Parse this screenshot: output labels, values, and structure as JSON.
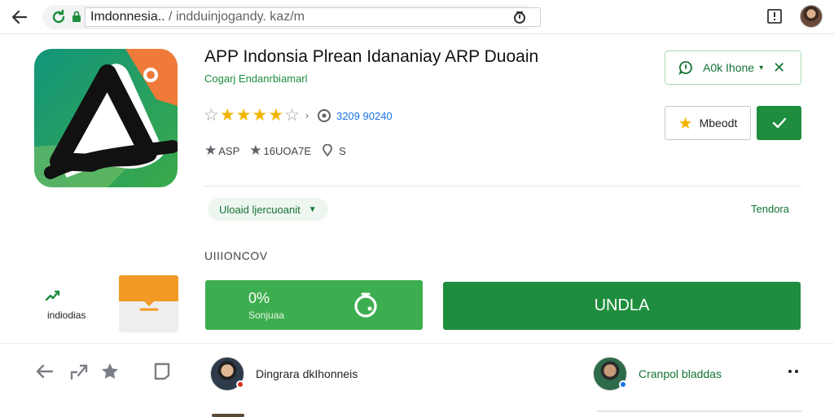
{
  "browser": {
    "url_host": "Imdonnesia..",
    "url_path": " / indduinjogandy. kaz/m",
    "icons": [
      "back-arrow-icon",
      "reload-icon",
      "lock-icon",
      "share-icon",
      "extension-icon",
      "profile-avatar"
    ]
  },
  "app": {
    "title": "APP Indonsia Plrean Idananiay ARP Duoain",
    "developer": "Cogarj Endanrbiamarl",
    "rating": {
      "full_stars": 4,
      "empty_stars": 2,
      "separator": "›",
      "count": "3209 90240"
    },
    "meta": {
      "category": "ASP",
      "version": "16UOA7E",
      "age": "S"
    }
  },
  "buttons": {
    "outline_label": "A0k Ihone",
    "wishlist_label": "Mbeodt",
    "install_label": "UNDLA"
  },
  "chip": {
    "label": "Uloaid ljercuoanit"
  },
  "more_link": "Tendora",
  "section_label": "UIIIONCOV",
  "tiles": {
    "left_label": "indiodias"
  },
  "progress": {
    "percent_label": "0%",
    "sub_label": "Sonjuaa"
  },
  "bottom": {
    "author_1": "Dingrara dkIhonneis",
    "author_2": "Cranpol bladdas"
  },
  "colors": {
    "primary_green": "#1e8e3e",
    "light_green": "#3dae4f",
    "star_gold": "#f5b400",
    "orange": "#f29a26"
  }
}
